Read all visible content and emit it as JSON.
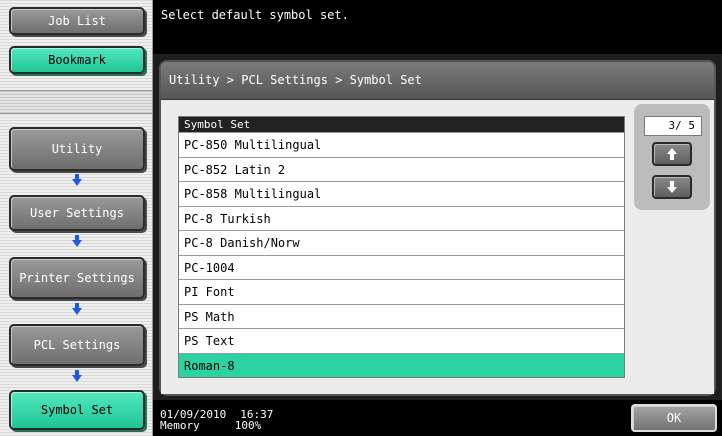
{
  "colors": {
    "accent_green": "#2bd2a2",
    "button_gray": "#8a8a8a",
    "arrow_blue": "#1b5be0",
    "bar_black": "#000000"
  },
  "left_panel": {
    "job_list": "Job List",
    "bookmark": "Bookmark",
    "nav": [
      "Utility",
      "User Settings",
      "Printer Settings",
      "PCL Settings",
      "Symbol Set"
    ]
  },
  "top_bar": {
    "message": "Select default symbol set."
  },
  "dialog": {
    "breadcrumb": "Utility > PCL Settings > Symbol Set",
    "list_header": "Symbol Set",
    "items": [
      {
        "label": "PC-850 Multilingual",
        "selected": false
      },
      {
        "label": "PC-852 Latin 2",
        "selected": false
      },
      {
        "label": "PC-858 Multilingual",
        "selected": false
      },
      {
        "label": "PC-8 Turkish",
        "selected": false
      },
      {
        "label": "PC-8 Danish/Norw",
        "selected": false
      },
      {
        "label": "PC-1004",
        "selected": false
      },
      {
        "label": "PI Font",
        "selected": false
      },
      {
        "label": "PS Math",
        "selected": false
      },
      {
        "label": "PS Text",
        "selected": false
      },
      {
        "label": "Roman-8",
        "selected": true
      }
    ],
    "page_indicator": "3/ 5",
    "page_up_icon": "arrow-up-icon",
    "page_down_icon": "arrow-down-icon"
  },
  "bottom_bar": {
    "date": "01/09/2010",
    "time": "16:37",
    "memory_label": "Memory",
    "memory_value": "100%",
    "ok_label": "OK"
  }
}
